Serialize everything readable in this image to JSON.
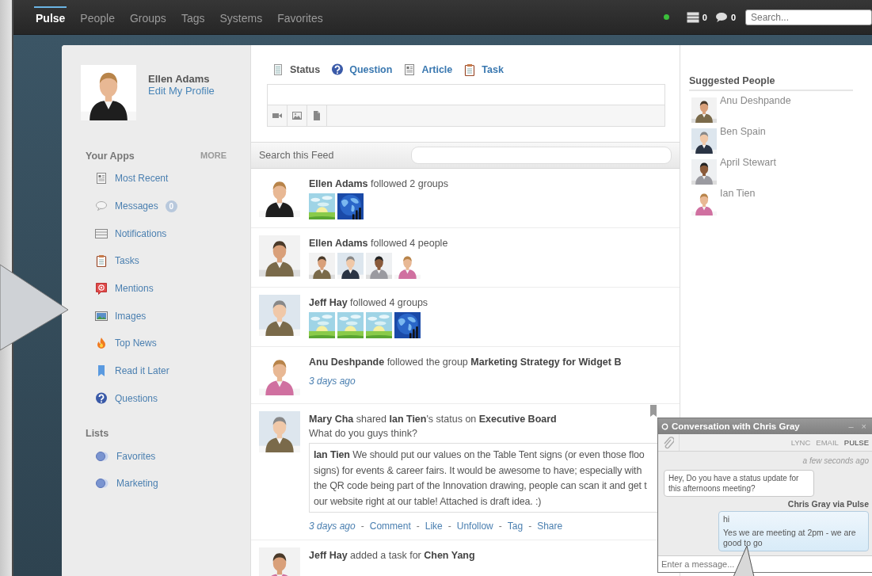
{
  "nav": {
    "tabs": [
      {
        "label": "Pulse",
        "selected": true
      },
      {
        "label": "People",
        "selected": false
      },
      {
        "label": "Groups",
        "selected": false
      },
      {
        "label": "Tags",
        "selected": false
      },
      {
        "label": "Systems",
        "selected": false
      },
      {
        "label": "Favorites",
        "selected": false
      }
    ],
    "presence": {
      "online": true
    },
    "counters": [
      {
        "kind": "notifications",
        "value": "0"
      },
      {
        "kind": "messages",
        "value": "0"
      }
    ],
    "search": {
      "placeholder": "Search..."
    }
  },
  "profile": {
    "name": "Ellen Adams",
    "link": "Edit My Profile"
  },
  "apps": {
    "title": "Your Apps",
    "more": "MORE",
    "items": [
      {
        "kind": "recent",
        "label": "Most Recent"
      },
      {
        "kind": "messages",
        "label": "Messages",
        "badge": "0"
      },
      {
        "kind": "notifications",
        "label": "Notifications"
      },
      {
        "kind": "tasks",
        "label": "Tasks"
      },
      {
        "kind": "mentions",
        "label": "Mentions"
      },
      {
        "kind": "images",
        "label": "Images"
      },
      {
        "kind": "news",
        "label": "Top News"
      },
      {
        "kind": "later",
        "label": "Read it Later"
      },
      {
        "kind": "questions",
        "label": "Questions"
      }
    ]
  },
  "lists": {
    "title": "Lists",
    "items": [
      {
        "label": "Favorites"
      },
      {
        "label": "Marketing"
      }
    ]
  },
  "composer": {
    "tabs": [
      {
        "kind": "status",
        "label": "Status",
        "selected": true
      },
      {
        "kind": "question",
        "label": "Question",
        "selected": false
      },
      {
        "kind": "article",
        "label": "Article",
        "selected": false
      },
      {
        "kind": "task",
        "label": "Task",
        "selected": false
      }
    ]
  },
  "feed": {
    "search_label": "Search this Feed",
    "items": [
      {
        "kind": "groups",
        "text": "**Ellen Adams** followed 2 groups"
      },
      {
        "kind": "people",
        "text": "**Ellen Adams** followed 4 people"
      },
      {
        "kind": "groups",
        "text": "**Jeff Hay** followed 4 groups"
      },
      {
        "kind": "activity",
        "text": "**Anu Deshpande** followed the group **Marketing Strategy for Widget B**",
        "time": "3 days ago"
      },
      {
        "kind": "share",
        "text": "**Mary Cha** shared **Ian Tien**'s status on **Executive Board**",
        "comment": "What do you guys think?",
        "quote_lines": [
          "**Ian Tien** We should put our values on the Table Tent signs (or even those floo",
          "signs) for events & career fairs. It would be awesome to have; especially with",
          "the QR code being part of the Innovation drawing, people can scan it and get t",
          "our website right at our table! Attached is draft idea. :)"
        ],
        "time": "3 days ago",
        "separator": "-",
        "actions": [
          "Comment",
          "Like",
          "Unfollow",
          "Tag",
          "Share"
        ]
      },
      {
        "kind": "activity",
        "text": "**Jeff Hay** added a task for **Chen Yang**"
      }
    ]
  },
  "suggested": {
    "title": "Suggested People",
    "people": [
      "Anu Deshpande",
      "Ben Spain",
      "April Stewart",
      "Ian Tien"
    ]
  },
  "chat": {
    "title": "Conversation with Chris Gray",
    "minimize": "–",
    "close": "×",
    "channels": [
      {
        "label": "LYNC",
        "selected": false
      },
      {
        "label": "EMAIL",
        "selected": false
      },
      {
        "label": "PULSE",
        "selected": true
      }
    ],
    "time": "a few seconds ago",
    "messages": [
      {
        "kind": "received",
        "lines": [
          "Hey, Do you have a status update for this afternoons meeting?"
        ]
      },
      {
        "kind": "sender",
        "lines": [
          "Chris Gray via Pulse"
        ]
      },
      {
        "kind": "sent",
        "lines": [
          "hi",
          "Yes we are meeting at 2pm - we are good to go"
        ]
      }
    ],
    "input": {
      "placeholder": "Enter a message..."
    }
  }
}
